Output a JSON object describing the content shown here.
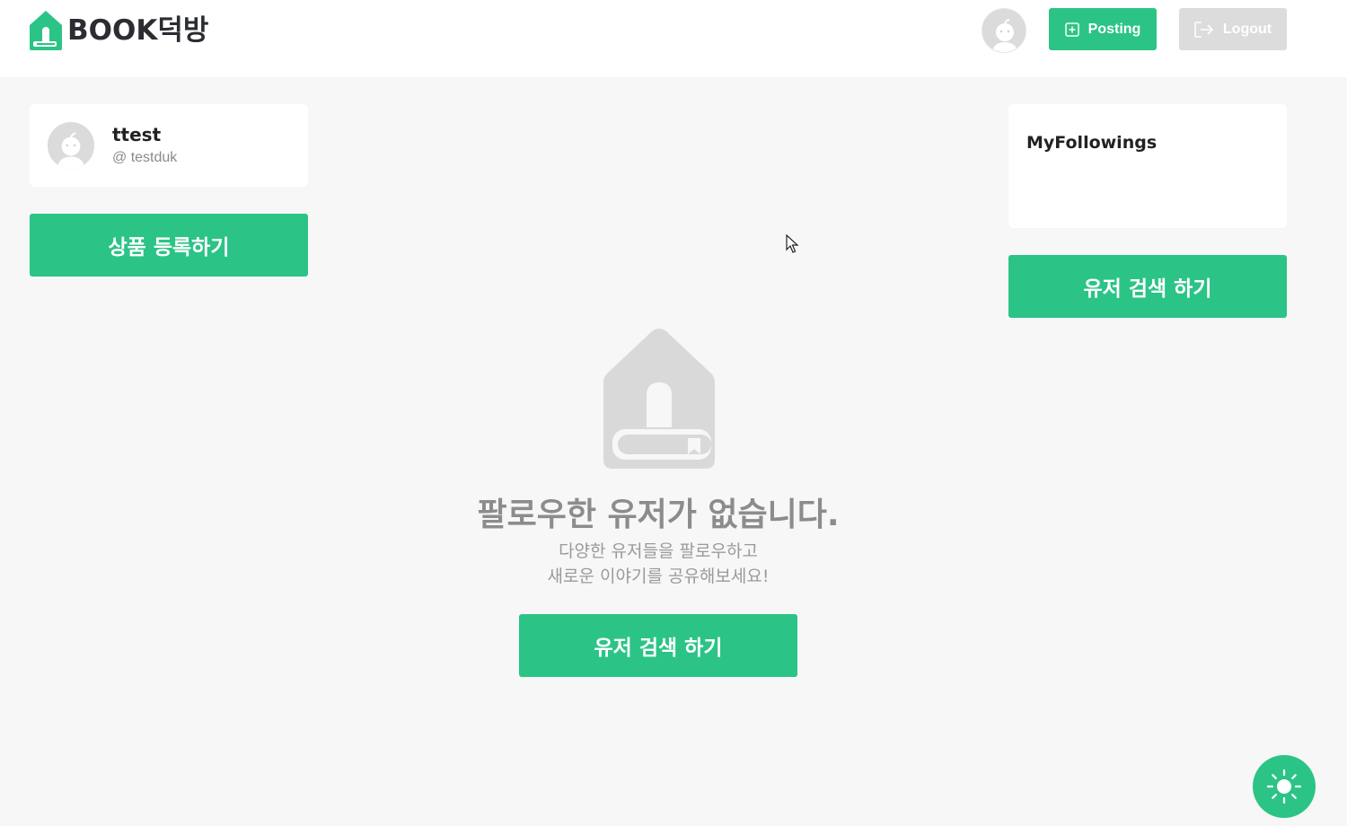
{
  "header": {
    "logo_text": "BOOK덕방",
    "posting_label": "Posting",
    "logout_label": "Logout"
  },
  "profile": {
    "name": "ttest",
    "handle": "@ testduk"
  },
  "left": {
    "register_label": "상품 등록하기"
  },
  "right": {
    "followings_title": "MyFollowings",
    "search_label": "유저 검색 하기"
  },
  "empty_state": {
    "title": "팔로우한 유저가 없습니다.",
    "line1": "다양한 유저들을 팔로우하고",
    "line2": "새로운 이야기를 공유해보세요!",
    "search_label": "유저 검색 하기"
  },
  "colors": {
    "accent": "#2bc486",
    "logout_bg": "#dcdcdc",
    "page_bg": "#f7f7f7"
  },
  "icons": {
    "logo": "house-book-icon",
    "posting": "plus-square-icon",
    "logout": "logout-icon",
    "avatar": "default-avatar-icon",
    "empty": "house-book-icon",
    "theme": "sun-icon",
    "cursor": "mouse-pointer-icon"
  }
}
